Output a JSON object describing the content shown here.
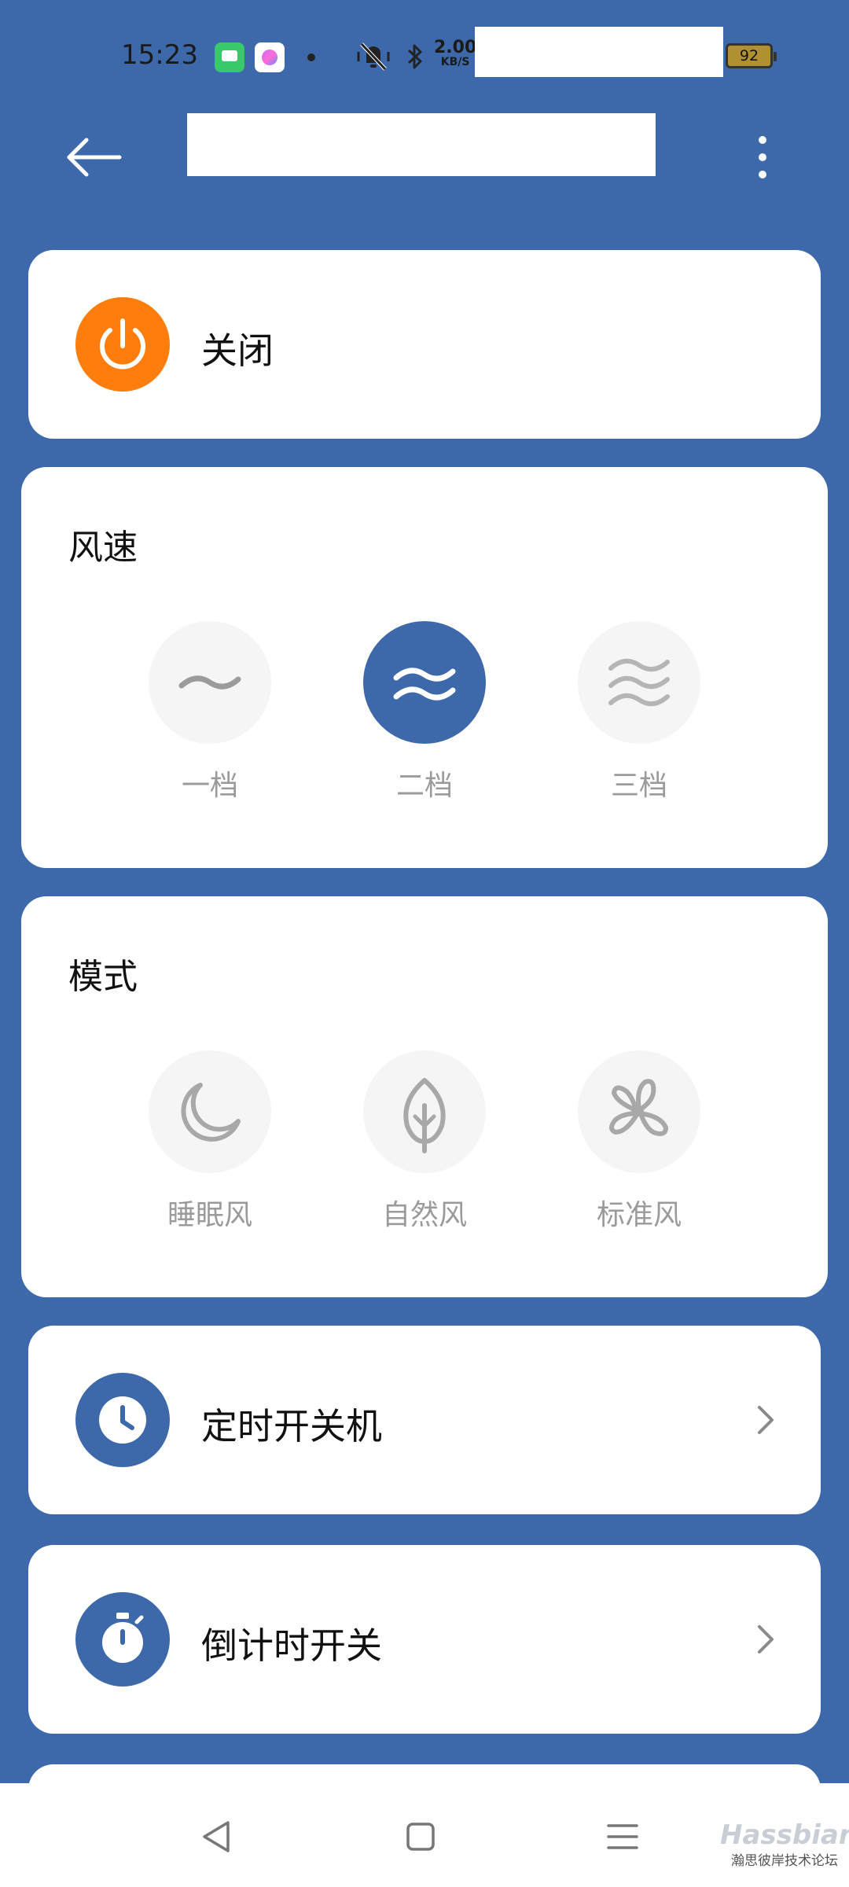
{
  "status_bar": {
    "time": "15:23",
    "net_speed_value": "2.00",
    "net_speed_unit": "KB/S",
    "battery": "92",
    "icons": [
      "messages-app-icon",
      "camera-app-icon",
      "notification-dot-icon",
      "vibrate-mute-icon",
      "bluetooth-icon",
      "battery-icon"
    ]
  },
  "header": {
    "title": "",
    "back_icon": "arrow-left-icon",
    "more_icon": "more-vertical-icon"
  },
  "power": {
    "label": "关闭",
    "icon": "power-icon",
    "color": "#ff7d0d"
  },
  "speed": {
    "title": "风速",
    "options": [
      {
        "label": "一档",
        "icon": "wave-1-icon",
        "active": false
      },
      {
        "label": "二档",
        "icon": "wave-2-icon",
        "active": true
      },
      {
        "label": "三档",
        "icon": "wave-3-icon",
        "active": false
      }
    ]
  },
  "mode": {
    "title": "模式",
    "options": [
      {
        "label": "睡眠风",
        "icon": "moon-icon",
        "active": false
      },
      {
        "label": "自然风",
        "icon": "leaf-icon",
        "active": false
      },
      {
        "label": "标准风",
        "icon": "fan-icon",
        "active": false
      }
    ]
  },
  "schedule": {
    "label": "定时开关机",
    "icon": "clock-icon"
  },
  "countdown": {
    "label": "倒计时开关",
    "icon": "stopwatch-icon"
  },
  "navbar": {
    "back_icon": "nav-back-icon",
    "home_icon": "nav-home-icon",
    "menu_icon": "nav-menu-icon"
  },
  "watermark": {
    "brand": "Hassbian",
    "sub": "瀚思彼岸技术论坛"
  },
  "colors": {
    "background": "#3d69ab",
    "accent": "#3d69ab",
    "power": "#ff7d0d",
    "inactive_circle": "#f5f5f5",
    "inactive_text": "#9b9b9b"
  }
}
